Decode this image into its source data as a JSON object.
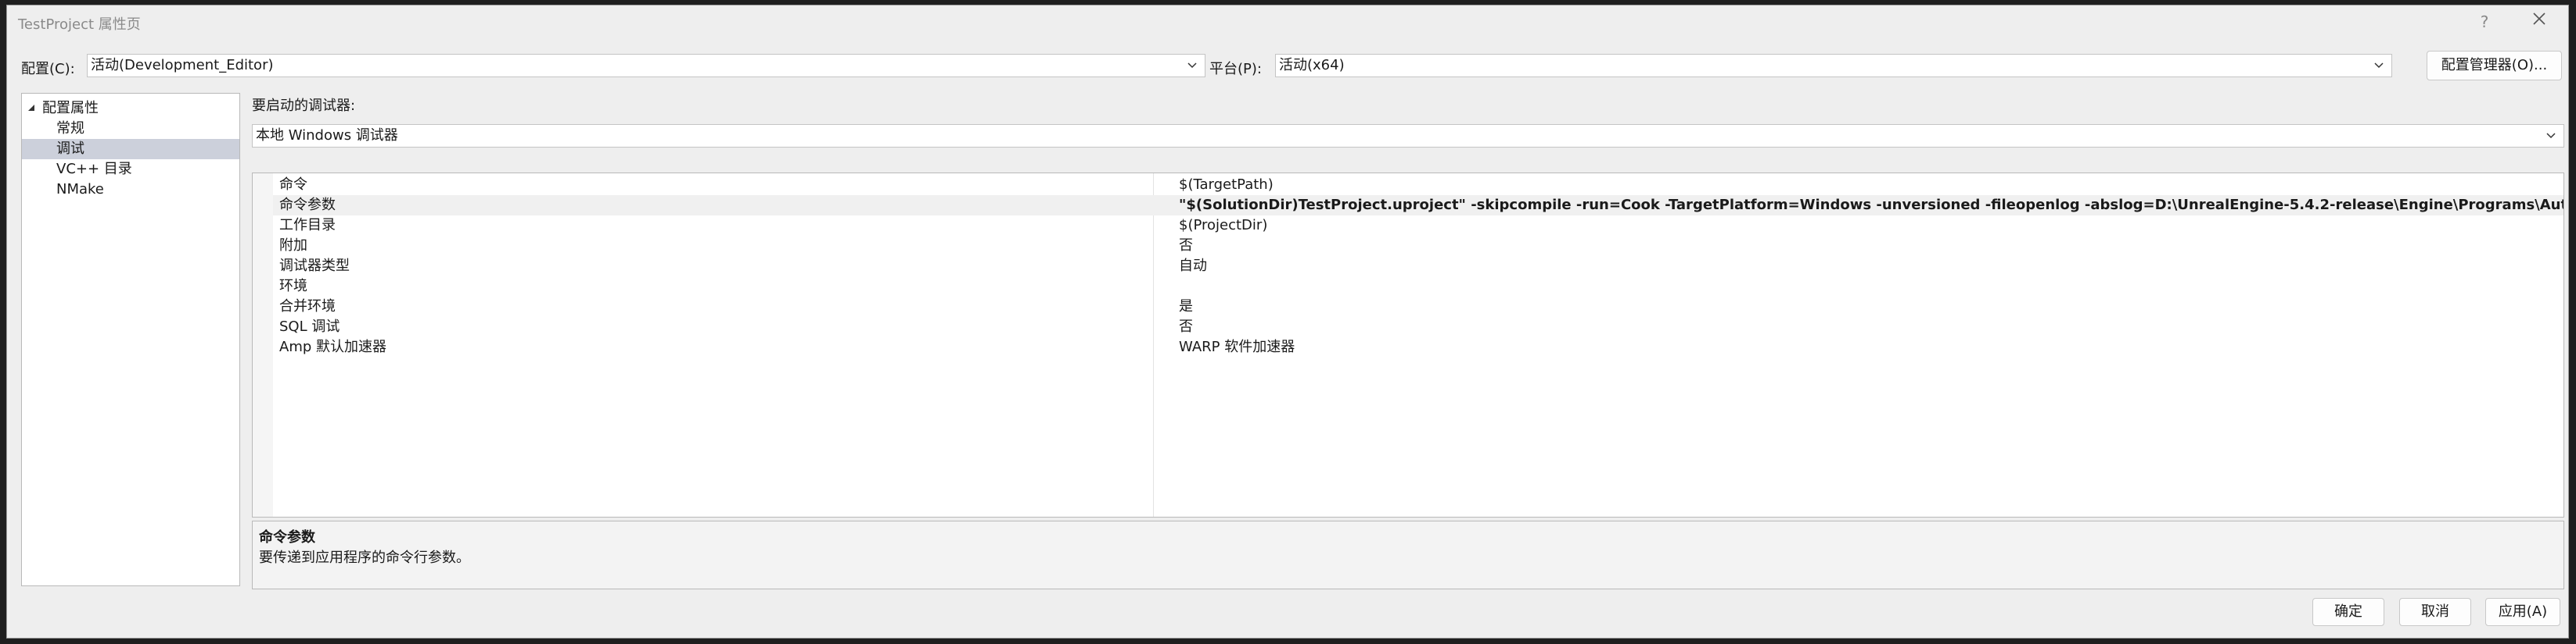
{
  "window": {
    "title": "TestProject 属性页"
  },
  "toolbar": {
    "config_label": "配置(C):",
    "config_value": "活动(Development_Editor)",
    "platform_label": "平台(P):",
    "platform_value": "活动(x64)",
    "config_manager": "配置管理器(O)..."
  },
  "tree": {
    "root": "配置属性",
    "items": [
      "常规",
      "调试",
      "VC++ 目录",
      "NMake"
    ],
    "selected": "调试"
  },
  "debugger": {
    "label": "要启动的调试器:",
    "value": "本地 Windows 调试器"
  },
  "properties": [
    {
      "name": "命令",
      "value": "$(TargetPath)"
    },
    {
      "name": "命令参数",
      "value": "\"$(SolutionDir)TestProject.uproject\" -skipcompile  -run=Cook -TargetPlatform=Windows -unversioned -fileopenlog -abslog=D:\\UnrealEngine-5.4.2-release\\Engine\\Programs\\AutomationTool\\Save"
    },
    {
      "name": "工作目录",
      "value": "$(ProjectDir)"
    },
    {
      "name": "附加",
      "value": "否"
    },
    {
      "name": "调试器类型",
      "value": "自动"
    },
    {
      "name": "环境",
      "value": ""
    },
    {
      "name": "合并环境",
      "value": "是"
    },
    {
      "name": "SQL 调试",
      "value": "否"
    },
    {
      "name": "Amp 默认加速器",
      "value": "WARP 软件加速器"
    }
  ],
  "description": {
    "title": "命令参数",
    "text": "要传递到应用程序的命令行参数。"
  },
  "footer": {
    "ok": "确定",
    "cancel": "取消",
    "apply": "应用(A)"
  },
  "colors": {
    "selection": "#ccd0db",
    "dialog_bg": "#eeeeee"
  }
}
